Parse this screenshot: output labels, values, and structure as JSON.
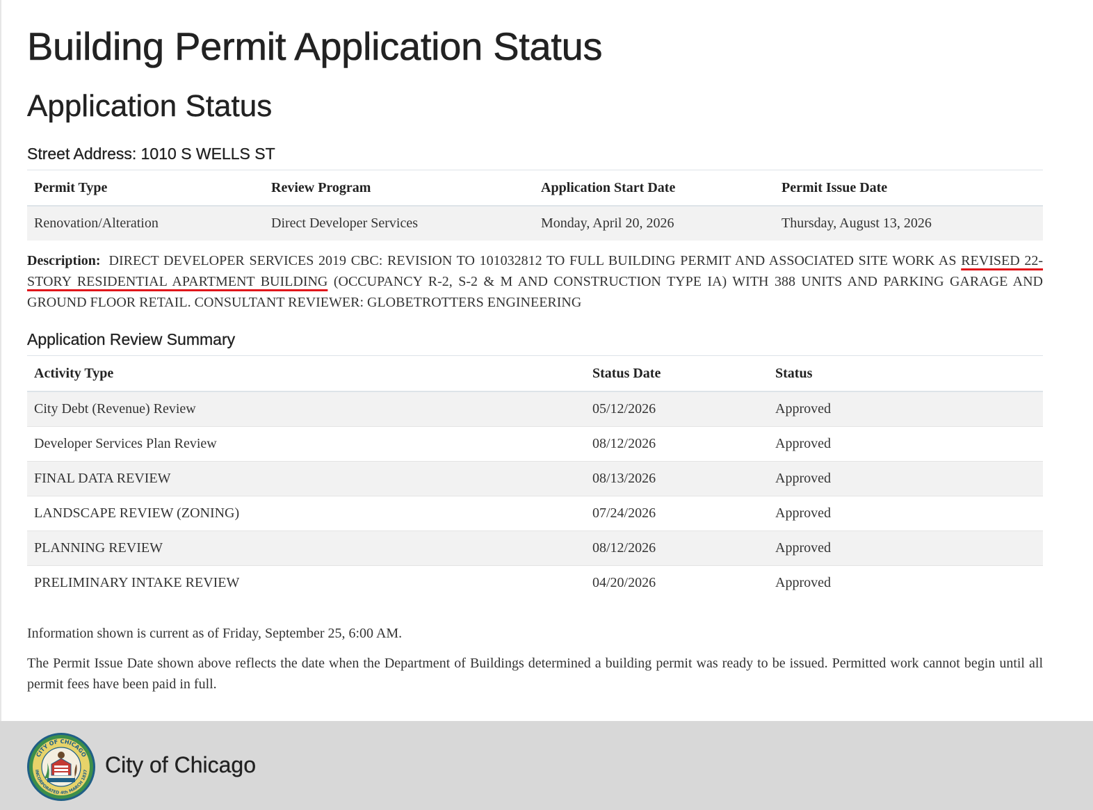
{
  "page": {
    "title": "Building Permit Application Status",
    "subtitle": "Application Status"
  },
  "address": {
    "label": "Street Address:",
    "value": "1010 S WELLS ST"
  },
  "permit_table": {
    "headers": [
      "Permit Type",
      "Review Program",
      "Application Start Date",
      "Permit Issue Date"
    ],
    "row": [
      "Renovation/Alteration",
      "Direct Developer Services",
      "Monday, April 20, 2026",
      "Thursday, August 13, 2026"
    ]
  },
  "description": {
    "label": "Description:",
    "text_before": "DIRECT DEVELOPER SERVICES 2019 CBC: REVISION TO 101032812 TO FULL BUILDING PERMIT AND ASSOCIATED SITE WORK AS ",
    "text_highlight": "REVISED 22-STORY RESIDENTIAL APARTMENT BUILDING",
    "text_after": " (OCCUPANCY R-2, S-2 & M AND CONSTRUCTION TYPE IA) WITH 388 UNITS AND PARKING GARAGE AND GROUND FLOOR RETAIL. CONSULTANT REVIEWER: GLOBETROTTERS ENGINEERING",
    "highlight_color": "#e0161b"
  },
  "review_summary": {
    "title": "Application Review Summary",
    "headers": [
      "Activity Type",
      "Status Date",
      "Status"
    ],
    "rows": [
      [
        "City Debt (Revenue) Review",
        "05/12/2026",
        "Approved"
      ],
      [
        "Developer Services Plan Review",
        "08/12/2026",
        "Approved"
      ],
      [
        "FINAL DATA REVIEW",
        "08/13/2026",
        "Approved"
      ],
      [
        "LANDSCAPE REVIEW (ZONING)",
        "07/24/2026",
        "Approved"
      ],
      [
        "PLANNING REVIEW",
        "08/12/2026",
        "Approved"
      ],
      [
        "PRELIMINARY INTAKE REVIEW",
        "04/20/2026",
        "Approved"
      ]
    ]
  },
  "notes": {
    "current_as_of": "Information shown is current as of Friday, September 25, 6:00 AM.",
    "disclaimer": "The Permit Issue Date shown above reflects the date when the Department of Buildings determined a building permit was ready to be issued. Permitted work cannot begin until all permit fees have been paid in full."
  },
  "footer": {
    "org_name": "City of Chicago",
    "seal_icon": "city-of-chicago-seal-icon",
    "seal_text_top": "CITY OF CHICAGO",
    "seal_text_bottom": "INCORPORATED 4th MARCH 1837"
  }
}
